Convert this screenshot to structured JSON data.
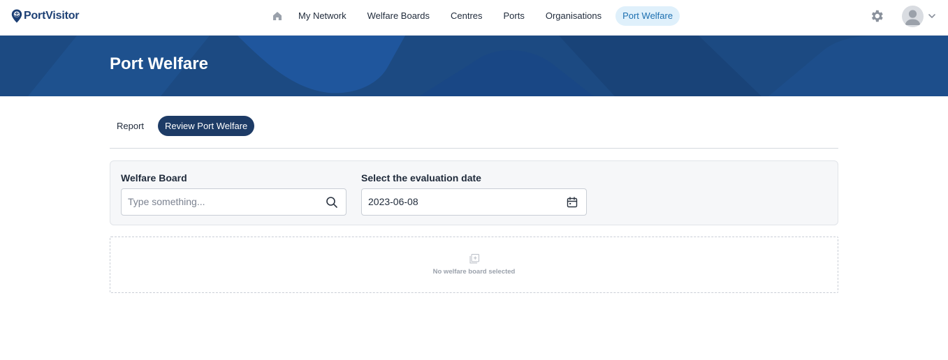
{
  "app": {
    "brand": "PortVisitor",
    "colors": {
      "brand": "#1c3f74",
      "banner": "#1c4a82",
      "active_nav_bg": "#dff0fb",
      "active_tab_bg": "#1d3b66"
    }
  },
  "nav": {
    "home_icon": "home-icon",
    "items": [
      {
        "label": "My Network",
        "active": false
      },
      {
        "label": "Welfare Boards",
        "active": false
      },
      {
        "label": "Centres",
        "active": false
      },
      {
        "label": "Ports",
        "active": false
      },
      {
        "label": "Organisations",
        "active": false
      },
      {
        "label": "Port Welfare",
        "active": true
      }
    ],
    "settings_icon": "gear-icon",
    "user_icon": "avatar-icon",
    "menu_icon": "chevron-down-icon"
  },
  "banner": {
    "title": "Port Welfare"
  },
  "tabs": [
    {
      "label": "Report",
      "active": false
    },
    {
      "label": "Review Port Welfare",
      "active": true
    }
  ],
  "filters": {
    "welfare_board": {
      "label": "Welfare Board",
      "placeholder": "Type something...",
      "value": "",
      "icon": "search-icon"
    },
    "evaluation_date": {
      "label": "Select the evaluation date",
      "value": "2023-06-08",
      "icon": "calendar-icon"
    }
  },
  "empty_state": {
    "icon": "add-square-icon",
    "text": "No welfare board selected"
  }
}
